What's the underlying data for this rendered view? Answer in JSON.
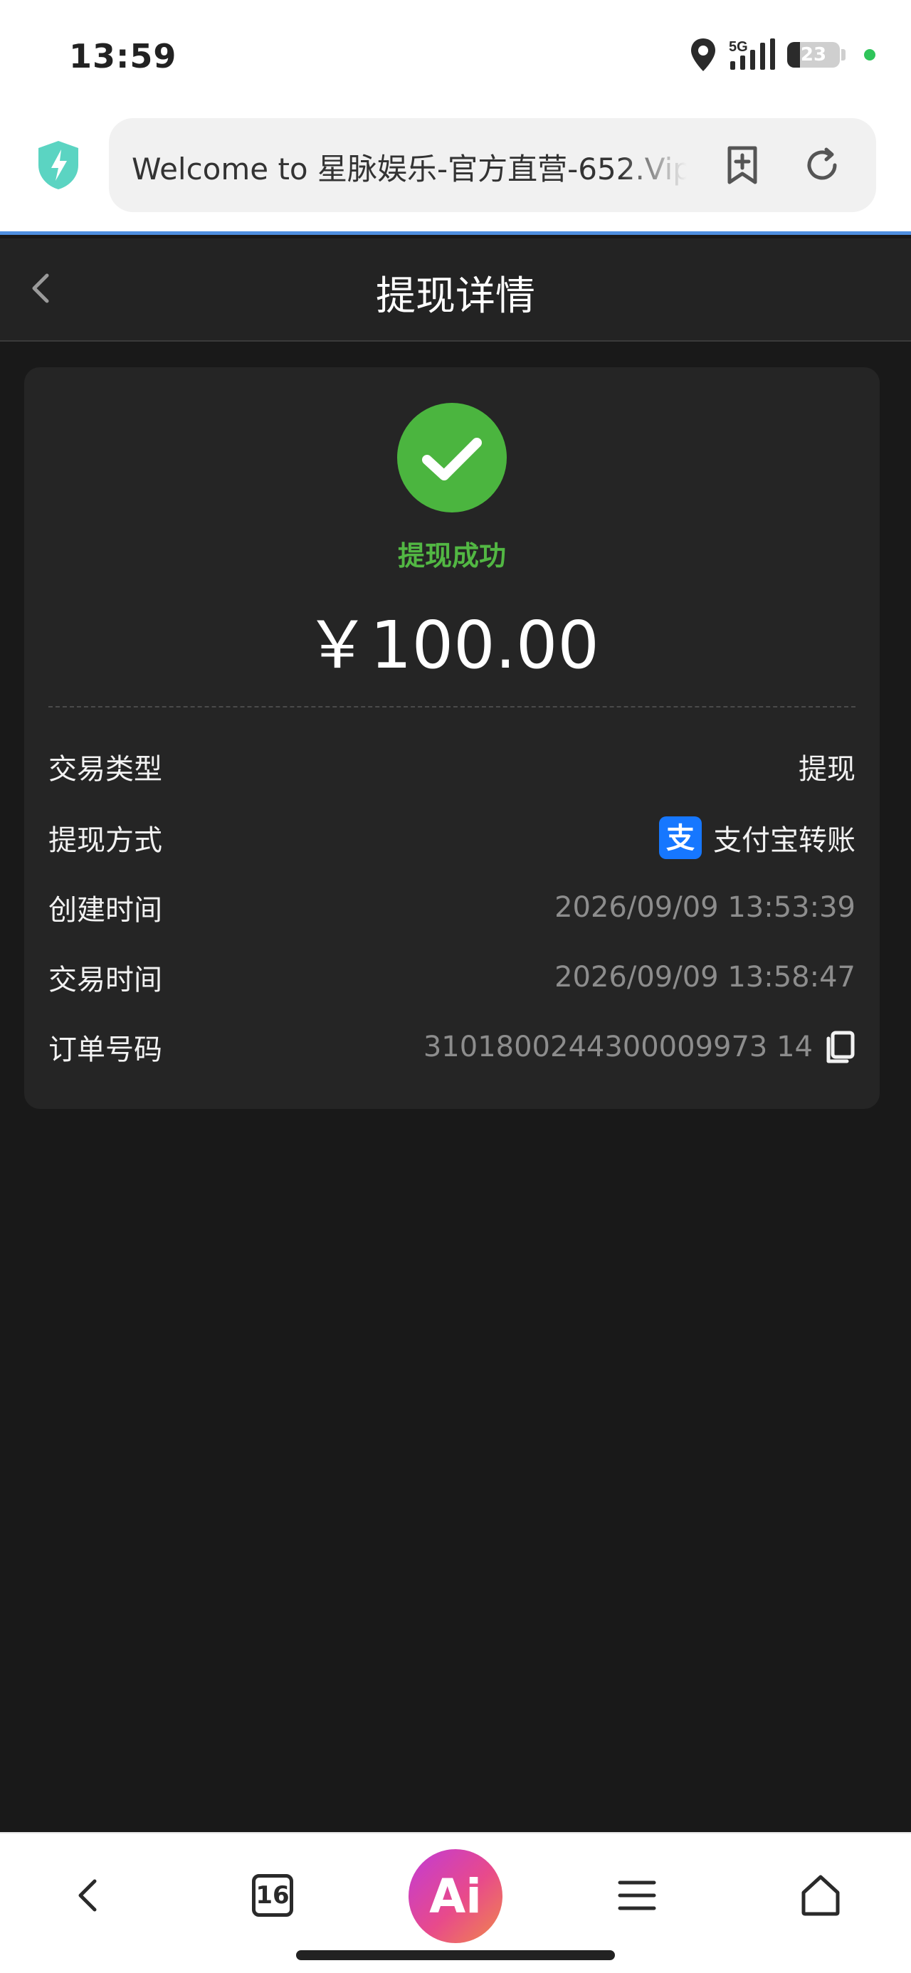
{
  "status_bar": {
    "time": "13:59",
    "network": "5G",
    "battery": "23",
    "icons": [
      "location-icon",
      "signal-icon",
      "battery-icon"
    ]
  },
  "browser": {
    "url_text": "Welcome to 星脉娱乐-官方直营-652.Vip",
    "icons": [
      "shield-bolt-icon",
      "bookmark-add-icon",
      "refresh-icon"
    ]
  },
  "header": {
    "title": "提现详情"
  },
  "detail": {
    "status": "提现成功",
    "amount": "￥100.00",
    "rows": [
      {
        "label": "交易类型",
        "value": "提现"
      },
      {
        "label": "提现方式",
        "value": "支付宝转账"
      },
      {
        "label": "创建时间",
        "value": "2026/09/09 13:53:39"
      },
      {
        "label": "交易时间",
        "value": "2026/09/09 13:58:47"
      },
      {
        "label": "订单号码",
        "value": "3101800244300009973 14"
      }
    ],
    "order_number": "31018002443000099731 4"
  },
  "alipay_glyph": "支",
  "bottom_nav": {
    "tab_count": "16",
    "ai_label": "Ai"
  },
  "colors": {
    "success": "#4bb53f",
    "background": "#191919",
    "card": "#252525",
    "alipay": "#1677ff",
    "progress_line": "#4f8fe0"
  }
}
